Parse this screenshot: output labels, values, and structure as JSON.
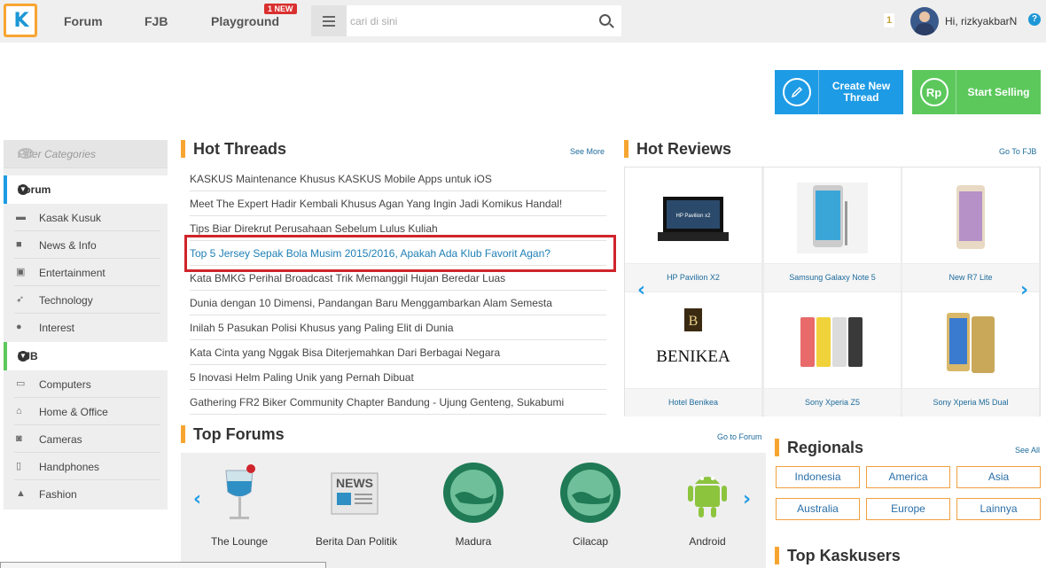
{
  "nav": {
    "logo_text": "K",
    "forum": "Forum",
    "fjb": "FJB",
    "playground": "Playground",
    "new_badge": "1 NEW",
    "search_placeholder": "cari di sini",
    "notif_count": "1",
    "greeting": "Hi, rizkyakbarN",
    "help": "?"
  },
  "actions": {
    "create_label": "Create New Thread",
    "sell_label": "Start Selling",
    "sell_icon": "Rp"
  },
  "sidebar": {
    "filter_placeholder": "Filter Categories",
    "forum_head": "Forum",
    "forum_items": [
      {
        "label": "Kasak Kusuk",
        "icon": "chat-icon"
      },
      {
        "label": "News & Info",
        "icon": "briefcase-icon"
      },
      {
        "label": "Entertainment",
        "icon": "tv-icon"
      },
      {
        "label": "Technology",
        "icon": "rocket-icon"
      },
      {
        "label": "Interest",
        "icon": "palette-icon"
      }
    ],
    "fjb_head": "FJB",
    "fjb_items": [
      {
        "label": "Computers",
        "icon": "monitor-icon"
      },
      {
        "label": "Home & Office",
        "icon": "home-icon"
      },
      {
        "label": "Cameras",
        "icon": "camera-icon"
      },
      {
        "label": "Handphones",
        "icon": "phone-icon"
      },
      {
        "label": "Fashion",
        "icon": "shirt-icon"
      }
    ]
  },
  "hot_threads": {
    "title": "Hot Threads",
    "link": "See More",
    "items": [
      "KASKUS Maintenance Khusus KASKUS Mobile Apps untuk iOS",
      "Meet The Expert Hadir Kembali Khusus Agan Yang Ingin Jadi Komikus Handal!",
      "Tips Biar Direkrut Perusahaan Sebelum Lulus Kuliah",
      "Top 5 Jersey Sepak Bola Musim 2015/2016, Apakah Ada Klub Favorit Agan?",
      "Kata BMKG Perihal Broadcast Trik Memanggil Hujan Beredar Luas",
      "Dunia dengan 10 Dimensi, Pandangan Baru Menggambarkan Alam Semesta",
      "Inilah 5 Pasukan Polisi Khusus yang Paling Elit di Dunia",
      "Kata Cinta yang Nggak Bisa Diterjemahkan Dari Berbagai Negara",
      "5 Inovasi Helm Paling Unik yang Pernah Dibuat",
      "Gathering FR2 Biker Community Chapter Bandung - Ujung Genteng, Sukabumi"
    ]
  },
  "hot_reviews": {
    "title": "Hot Reviews",
    "link": "Go To FJB",
    "items": [
      {
        "name": "HP Pavilion X2",
        "img_text": "HP Pavilion x2"
      },
      {
        "name": "Samsung Galaxy Note 5",
        "img_text": ""
      },
      {
        "name": "New R7 Lite",
        "img_text": ""
      },
      {
        "name": "Hotel Benikea",
        "img_text": "BENIKEA"
      },
      {
        "name": "Sony Xperia Z5",
        "img_text": ""
      },
      {
        "name": "Sony Xperia M5 Dual",
        "img_text": ""
      }
    ]
  },
  "top_forums": {
    "title": "Top Forums",
    "link": "Go to Forum",
    "items": [
      {
        "name": "The Lounge"
      },
      {
        "name": "Berita Dan Politik",
        "img_text": "NEWS"
      },
      {
        "name": "Madura"
      },
      {
        "name": "Cilacap"
      },
      {
        "name": "Android"
      }
    ]
  },
  "regionals": {
    "title": "Regionals",
    "link": "See All",
    "items": [
      "Indonesia",
      "America",
      "Asia",
      "Australia",
      "Europe",
      "Lainnya"
    ]
  },
  "top_kaskusers": {
    "title": "Top Kaskusers"
  },
  "colors": {
    "accent_blue": "#1e9be5",
    "accent_green": "#5cc85c",
    "accent_orange": "#f7a531",
    "highlight_red": "#d0242b"
  }
}
